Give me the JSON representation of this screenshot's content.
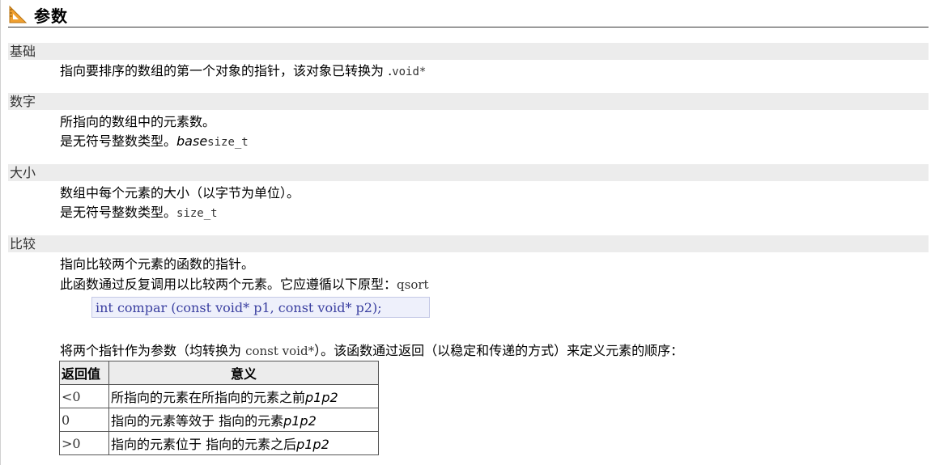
{
  "section": {
    "icon": "triangle-ruler-icon",
    "title": "参数"
  },
  "params": [
    {
      "term": "基础",
      "lines": [
        {
          "text": "指向要排序的数组的第一个对象的指针，该对象已转换为 .",
          "code": "void*"
        }
      ]
    },
    {
      "term": "数字",
      "lines": [
        {
          "text": "所指向的数组中的元素数。"
        },
        {
          "text": "是无符号整数类型。",
          "italic": "base",
          "code": "size_t"
        }
      ]
    },
    {
      "term": "大小",
      "lines": [
        {
          "text": "数组中每个元素的大小（以字节为单位）。"
        },
        {
          "text": "是无符号整数类型。",
          "code": "size_t"
        }
      ]
    },
    {
      "term": "比较",
      "lines": [
        {
          "text": "指向比较两个元素的函数的指针。"
        },
        {
          "text": "此函数通过反复调用以比较两个元素。它应遵循以下原型：",
          "code": "qsort"
        }
      ],
      "prototype": "int compar (const void* p1, const void* p2);",
      "after": {
        "before": "将两个指针作为参数（均转换为 ",
        "code": "const void*",
        "after": "）。该函数通过返回（以稳定和传递的方式）来定义元素的顺序："
      }
    }
  ],
  "table": {
    "headers": [
      "返回值",
      "意义"
    ],
    "rows": [
      {
        "value": "<0",
        "text": "所指向的元素在所指向的元素之前",
        "vars": "p1p2"
      },
      {
        "value": "0",
        "text": "指向的元素等效于 指向的元素",
        "vars": "p1p2"
      },
      {
        "value": ">0",
        "text": "指向的元素位于 指向的元素之后",
        "vars": "p1p2"
      }
    ]
  }
}
